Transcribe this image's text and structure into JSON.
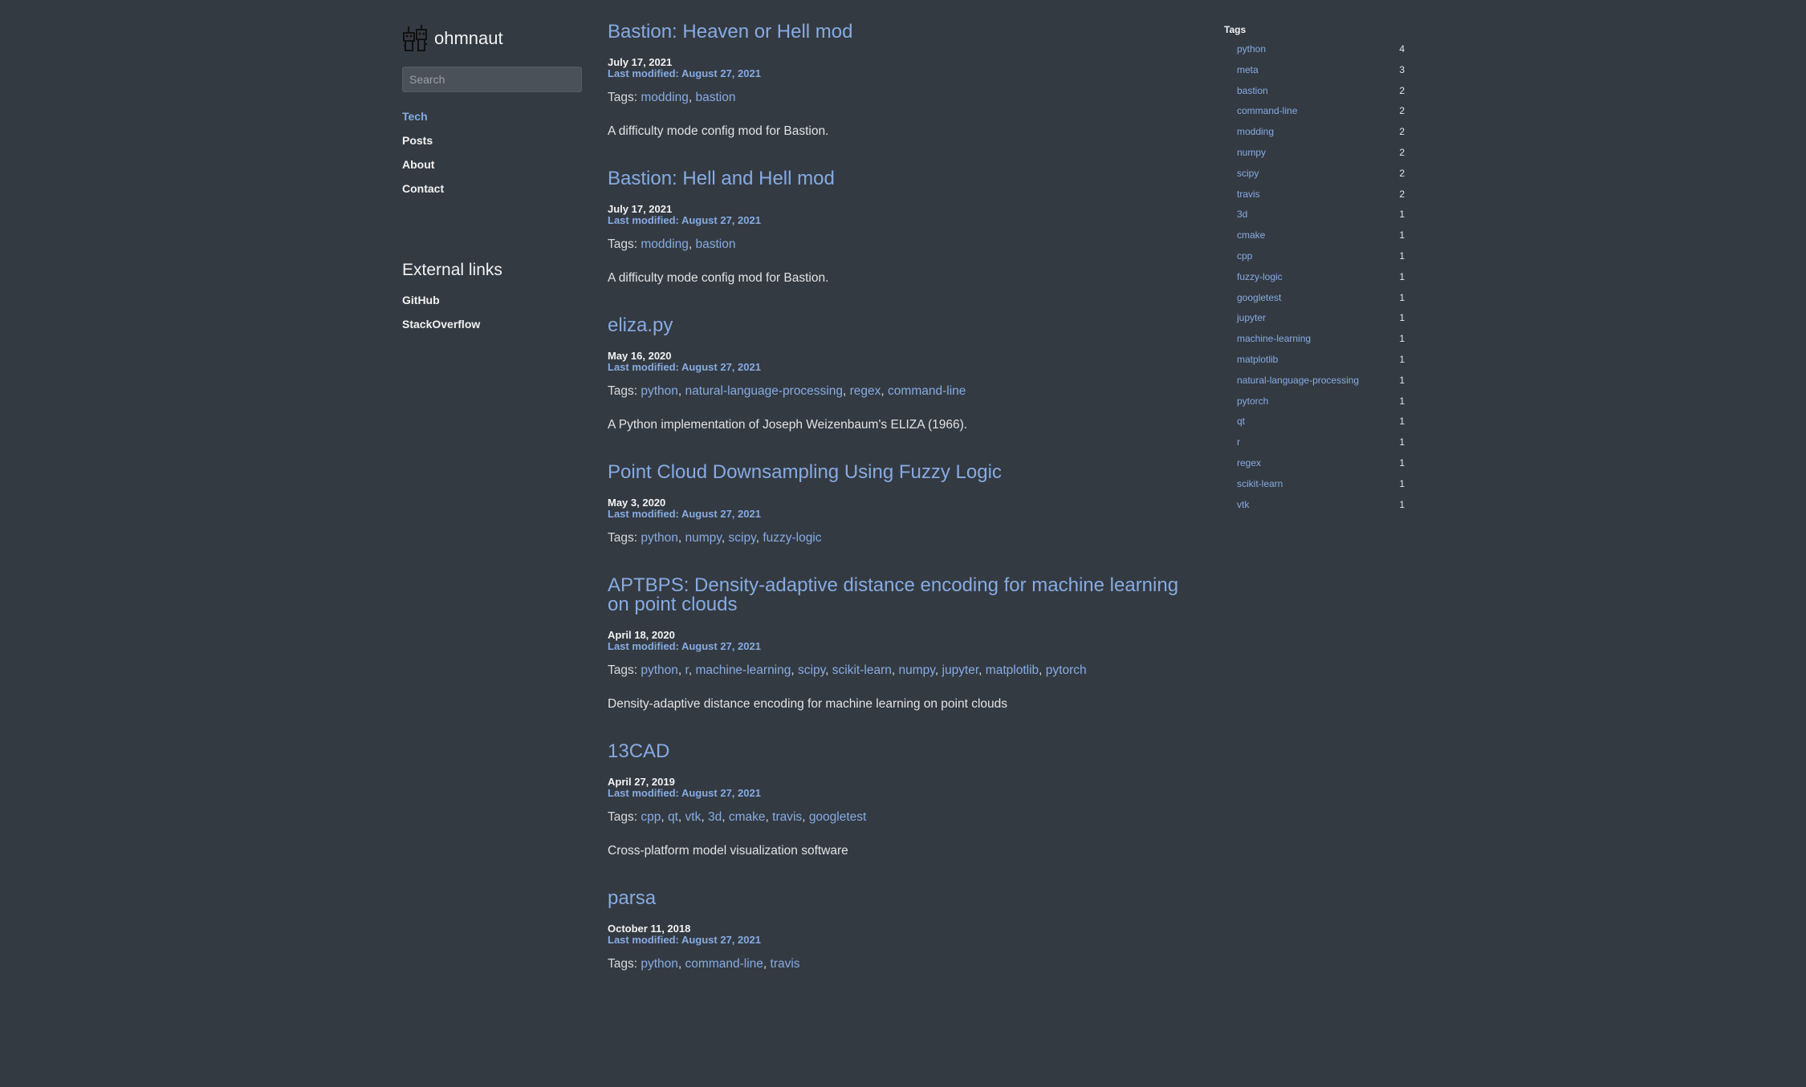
{
  "site": {
    "name": "ohmnaut",
    "search_placeholder": "Search"
  },
  "nav": {
    "items": [
      {
        "label": "Tech"
      },
      {
        "label": "Posts"
      },
      {
        "label": "About"
      },
      {
        "label": "Contact"
      }
    ]
  },
  "external": {
    "heading": "External links",
    "links": [
      {
        "label": "GitHub"
      },
      {
        "label": "StackOverflow"
      }
    ]
  },
  "posts": [
    {
      "title": "Bastion: Heaven or Hell mod",
      "date": "July 17, 2021",
      "modified": "Last modified: August 27, 2021",
      "tags": [
        "modding",
        "bastion"
      ],
      "description": "A difficulty mode config mod for Bastion."
    },
    {
      "title": "Bastion: Hell and Hell mod",
      "date": "July 17, 2021",
      "modified": "Last modified: August 27, 2021",
      "tags": [
        "modding",
        "bastion"
      ],
      "description": "A difficulty mode config mod for Bastion."
    },
    {
      "title": "eliza.py",
      "date": "May 16, 2020",
      "modified": "Last modified: August 27, 2021",
      "tags": [
        "python",
        "natural-language-processing",
        "regex",
        "command-line"
      ],
      "description": "A Python implementation of Joseph Weizenbaum's ELIZA (1966)."
    },
    {
      "title": "Point Cloud Downsampling Using Fuzzy Logic",
      "date": "May 3, 2020",
      "modified": "Last modified: August 27, 2021",
      "tags": [
        "python",
        "numpy",
        "scipy",
        "fuzzy-logic"
      ],
      "description": ""
    },
    {
      "title": "APTBPS: Density-adaptive distance encoding for machine learning on point clouds",
      "date": "April 18, 2020",
      "modified": "Last modified: August 27, 2021",
      "tags": [
        "python",
        "r",
        "machine-learning",
        "scipy",
        "scikit-learn",
        "numpy",
        "jupyter",
        "matplotlib",
        "pytorch"
      ],
      "description": "Density-adaptive distance encoding for machine learning on point clouds"
    },
    {
      "title": "13CAD",
      "date": "April 27, 2019",
      "modified": "Last modified: August 27, 2021",
      "tags": [
        "cpp",
        "qt",
        "vtk",
        "3d",
        "cmake",
        "travis",
        "googletest"
      ],
      "description": "Cross-platform model visualization software"
    },
    {
      "title": "parsa",
      "date": "October 11, 2018",
      "modified": "Last modified: August 27, 2021",
      "tags": [
        "python",
        "command-line",
        "travis"
      ],
      "description": ""
    }
  ],
  "tags_label": "Tags: ",
  "tags_panel": {
    "heading": "Tags",
    "items": [
      {
        "name": "python",
        "count": "4"
      },
      {
        "name": "meta",
        "count": "3"
      },
      {
        "name": "bastion",
        "count": "2"
      },
      {
        "name": "command-line",
        "count": "2"
      },
      {
        "name": "modding",
        "count": "2"
      },
      {
        "name": "numpy",
        "count": "2"
      },
      {
        "name": "scipy",
        "count": "2"
      },
      {
        "name": "travis",
        "count": "2"
      },
      {
        "name": "3d",
        "count": "1"
      },
      {
        "name": "cmake",
        "count": "1"
      },
      {
        "name": "cpp",
        "count": "1"
      },
      {
        "name": "fuzzy-logic",
        "count": "1"
      },
      {
        "name": "googletest",
        "count": "1"
      },
      {
        "name": "jupyter",
        "count": "1"
      },
      {
        "name": "machine-learning",
        "count": "1"
      },
      {
        "name": "matplotlib",
        "count": "1"
      },
      {
        "name": "natural-language-processing",
        "count": "1"
      },
      {
        "name": "pytorch",
        "count": "1"
      },
      {
        "name": "qt",
        "count": "1"
      },
      {
        "name": "r",
        "count": "1"
      },
      {
        "name": "regex",
        "count": "1"
      },
      {
        "name": "scikit-learn",
        "count": "1"
      },
      {
        "name": "vtk",
        "count": "1"
      }
    ]
  },
  "icons": {
    "brand": "robot-logo-icon"
  },
  "colors": {
    "background": "#343a42",
    "link": "#86abe2",
    "text": "#f2f2f2"
  }
}
